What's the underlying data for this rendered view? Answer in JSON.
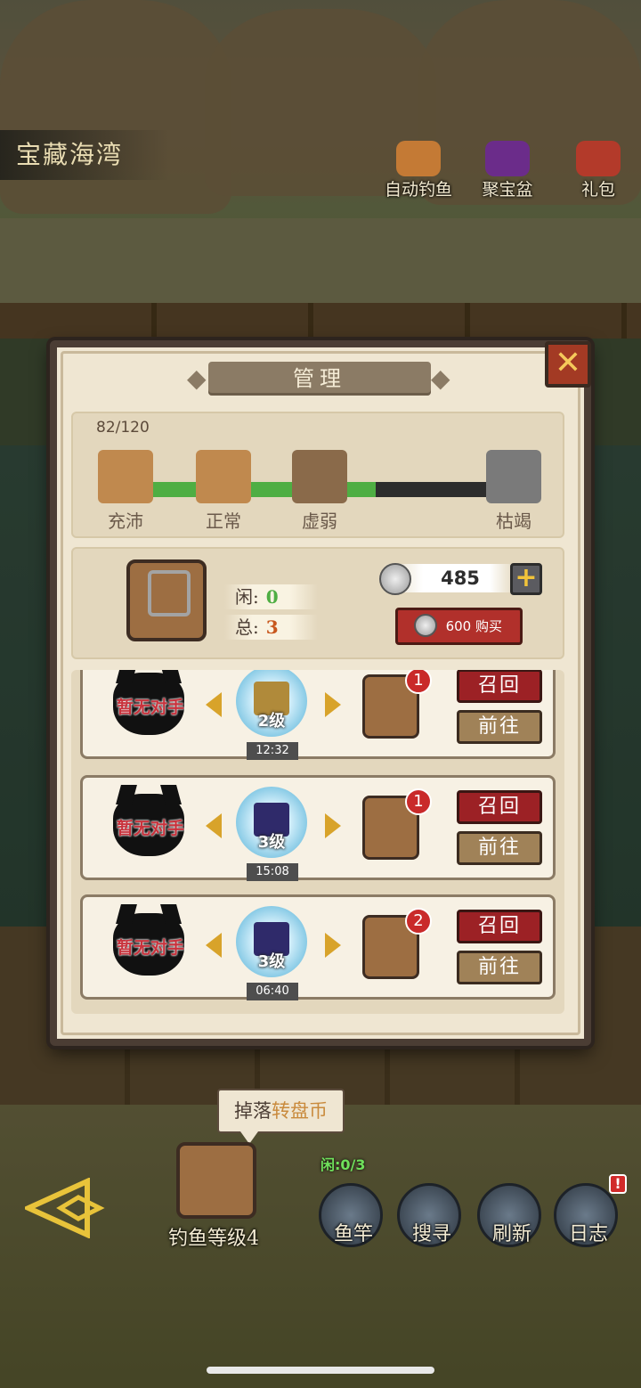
{
  "location_name": "宝藏海湾",
  "top_buttons": [
    {
      "label": "自动钓鱼",
      "icon": "cat-fisher-icon"
    },
    {
      "label": "聚宝盆",
      "icon": "treasure-chest-icon"
    },
    {
      "label": "礼包",
      "icon": "gift-box-icon"
    }
  ],
  "modal": {
    "title": "管理",
    "stamina": {
      "current": "82/120",
      "fill_fraction": 0.64,
      "stages": [
        "充沛",
        "正常",
        "虚弱",
        "枯竭"
      ]
    },
    "backpack": {
      "idle_label": "闲:",
      "idle_value": "0",
      "total_label": "总:",
      "total_value": "3"
    },
    "coins": "485",
    "buy_label": "600 购买",
    "slots": [
      {
        "opponent": "暂无对手",
        "level": "2级",
        "timer": "12:32",
        "badge": "1",
        "recall": "召回",
        "go": "前往",
        "gem_color": "#b08a3a"
      },
      {
        "opponent": "暂无对手",
        "level": "3级",
        "timer": "15:08",
        "badge": "1",
        "recall": "召回",
        "go": "前往",
        "gem_color": "#2f2a6a"
      },
      {
        "opponent": "暂无对手",
        "level": "3级",
        "timer": "06:40",
        "badge": "2",
        "recall": "召回",
        "go": "前往",
        "gem_color": "#2f2a6a"
      }
    ]
  },
  "bottom": {
    "tooltip_prefix": "掉落",
    "tooltip_item": "转盘币",
    "fishing_level": "钓鱼等级4",
    "idle_count": "闲:0/3",
    "buttons": [
      {
        "label": "鱼竿",
        "icon": "fishing-rod-icon"
      },
      {
        "label": "搜寻",
        "icon": "magnifier-icon"
      },
      {
        "label": "刷新",
        "icon": "refresh-scroll-icon"
      },
      {
        "label": "日志",
        "icon": "log-book-icon"
      }
    ],
    "alert": "!"
  },
  "colors": {
    "stamina_green": "#4fae43",
    "recall_red": "#9c2125",
    "go_brown": "#a08258",
    "badge_red": "#c92a2a",
    "idle_green": "#6fe05b",
    "total_orange": "#c8571d",
    "tooltip_item": "#c98a3c"
  }
}
